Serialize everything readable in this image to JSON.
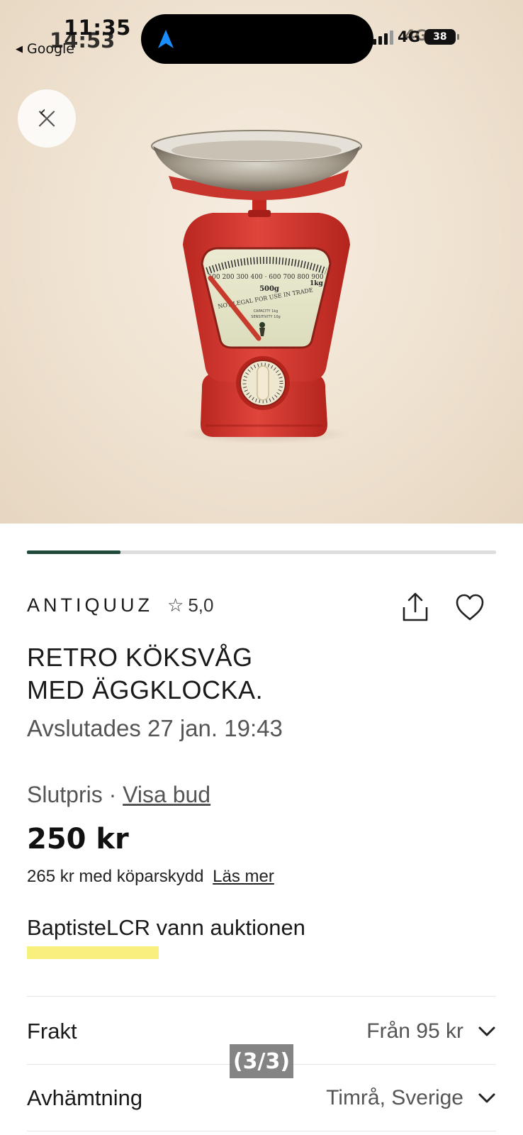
{
  "status_bar": {
    "time_primary": "11:35",
    "time_secondary": "14:53",
    "back_app_label": "Google",
    "network": "4G",
    "network_overlay": "4G",
    "battery": "38"
  },
  "gallery": {
    "progress_fraction": 0.2,
    "page_counter": "(3/3)"
  },
  "product": {
    "seller": "ANTIQUUZ",
    "rating_value": "5,0",
    "title_line1": "RETRO KÖKSVÅG",
    "title_line2": "MED ÄGGKLOCKA.",
    "ended_text": "Avslutades 27 jan. 19:43",
    "price_label": "Slutpris",
    "price_separator": "·",
    "show_bids_link": "Visa bud",
    "final_price": "250 kr",
    "protection_text": "265 kr med köparskydd",
    "read_more_link": "Läs mer",
    "winner_text": "BaptisteLCR vann auktionen"
  },
  "details": {
    "shipping_label": "Frakt",
    "shipping_value": "Från 95 kr",
    "pickup_label": "Avhämtning",
    "pickup_value": "Timrå, Sverige"
  },
  "colors": {
    "progress": "#1f4a3a",
    "highlight": "#f7f07c",
    "scale_red": "#d8352e",
    "island_arrow": "#1a8cff"
  },
  "icons": [
    "back-triangle-icon",
    "navigation-arrow-icon",
    "close-icon",
    "share-icon",
    "heart-icon",
    "star-icon",
    "chevron-down-icon"
  ]
}
